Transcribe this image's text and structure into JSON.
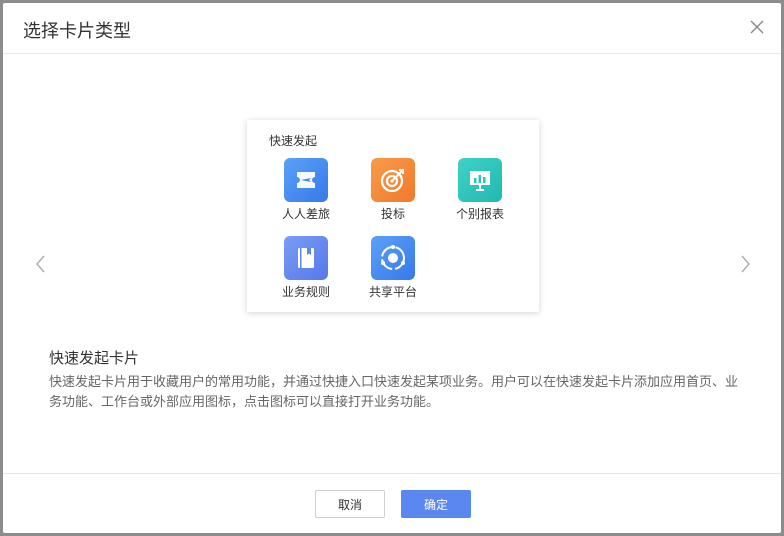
{
  "dialog": {
    "title": "选择卡片类型"
  },
  "card": {
    "title": "快速发起",
    "apps": [
      {
        "label": "人人差旅",
        "icon": "ticket-plane-icon",
        "color": "#4a8ef2"
      },
      {
        "label": "投标",
        "icon": "target-arrow-icon",
        "color": "#f5883a"
      },
      {
        "label": "个别报表",
        "icon": "chart-board-icon",
        "color": "#2cc6bd"
      },
      {
        "label": "业务规则",
        "icon": "book-icon",
        "color": "#5b87f0"
      },
      {
        "label": "共享平台",
        "icon": "share-cycle-icon",
        "color": "#4a8ef2"
      }
    ]
  },
  "description": {
    "title": "快速发起卡片",
    "text": "快速发起卡片用于收藏用户的常用功能，并通过快捷入口快速发起某项业务。用户可以在快速发起卡片添加应用首页、业务功能、工作台或外部应用图标，点击图标可以直接打开业务功能。"
  },
  "footer": {
    "cancel_label": "取消",
    "ok_label": "确定"
  }
}
